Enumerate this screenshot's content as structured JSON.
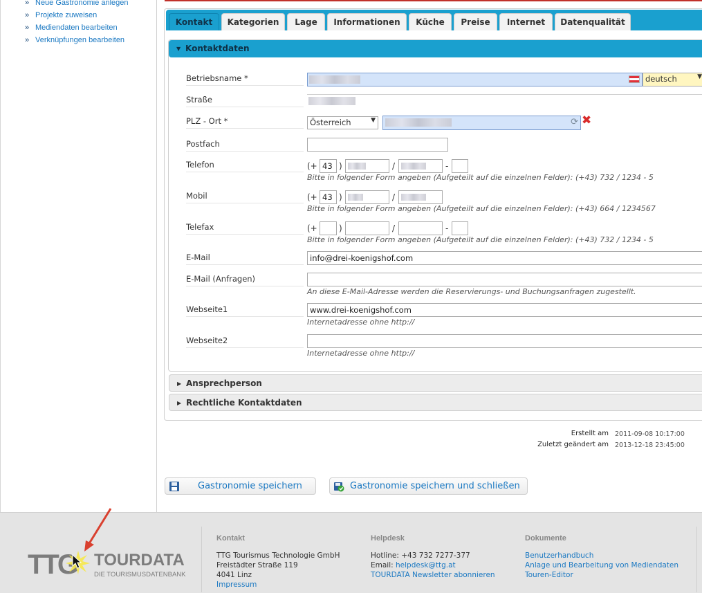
{
  "leftnav": {
    "items": [
      {
        "label": "Neue Gastronomie anlegen"
      },
      {
        "label": "Projekte zuweisen"
      },
      {
        "label": "Mediendaten bearbeiten"
      },
      {
        "label": "Verknüpfungen bearbeiten"
      }
    ],
    "arrow": "»"
  },
  "tabs": [
    "Kontakt",
    "Kategorien",
    "Lage",
    "Informationen",
    "Küche",
    "Preise",
    "Internet",
    "Datenqualität"
  ],
  "sections": {
    "kontaktdaten": "Kontaktdaten",
    "ansprechperson": "Ansprechperson",
    "rechtliche": "Rechtliche Kontaktdaten"
  },
  "form": {
    "betriebsname": {
      "label": "Betriebsname *",
      "language": "deutsch"
    },
    "strasse": {
      "label": "Straße"
    },
    "plz": {
      "label": "PLZ - Ort *",
      "country": "Österreich"
    },
    "postfach": {
      "label": "Postfach"
    },
    "telefon": {
      "label": "Telefon",
      "prefix": "(+",
      "country_code": "43",
      "close": ")",
      "slash": "/",
      "dash": "-",
      "hint": "Bitte in folgender Form angeben (Aufgeteilt auf die einzelnen Felder): (+43) 732 / 1234 - 5"
    },
    "mobil": {
      "label": "Mobil",
      "prefix": "(+",
      "country_code": "43",
      "close": ")",
      "slash": "/",
      "hint": "Bitte in folgender Form angeben (Aufgeteilt auf die einzelnen Felder): (+43) 664 / 1234567"
    },
    "telefax": {
      "label": "Telefax",
      "prefix": "(+",
      "country_code": "",
      "close": ")",
      "slash": "/",
      "dash": "-",
      "hint": "Bitte in folgender Form angeben (Aufgeteilt auf die einzelnen Felder): (+43) 732 / 1234 - 5"
    },
    "email": {
      "label": "E-Mail",
      "value": "info@drei-koenigshof.com"
    },
    "email_anfragen": {
      "label": "E-Mail (Anfragen)",
      "value": "",
      "hint": "An diese E-Mail-Adresse werden die Reservierungs- und Buchungsanfragen zugestellt."
    },
    "webseite1": {
      "label": "Webseite1",
      "value": "www.drei-koenigshof.com",
      "hint": "Internetadresse ohne http://"
    },
    "webseite2": {
      "label": "Webseite2",
      "value": "",
      "hint": "Internetadresse ohne http://"
    }
  },
  "meta": {
    "created_label": "Erstellt am",
    "created_value": "2011-09-08 10:17:00",
    "modified_label": "Zuletzt geändert am",
    "modified_value": "2013-12-18 23:45:00"
  },
  "buttons": {
    "save": "Gastronomie speichern",
    "save_close": "Gastronomie speichern und schließen"
  },
  "footer": {
    "logo_mark": "TTG",
    "logo_name": "TOURDATA",
    "logo_tagline": "DIE TOURISMUSDATENBANK",
    "kontakt": {
      "heading": "Kontakt",
      "lines": [
        "TTG Tourismus Technologie GmbH",
        "Freistädter Straße 119",
        "4041 Linz"
      ],
      "link": "Impressum"
    },
    "helpdesk": {
      "heading": "Helpdesk",
      "hotline": "Hotline: +43 732 7277-377",
      "email_prefix": "Email: ",
      "email": "helpdesk@ttg.at",
      "newsletter": "TOURDATA Newsletter abonnieren"
    },
    "dokumente": {
      "heading": "Dokumente",
      "links": [
        "Benutzerhandbuch",
        "Anlage und Bearbeitung von Mediendaten",
        "Touren-Editor"
      ]
    }
  },
  "colors": {
    "accent": "#1aa0cf",
    "link": "#1a78c2",
    "highlight_input": "#d4e4fa",
    "red_annotation": "#d9402f"
  }
}
